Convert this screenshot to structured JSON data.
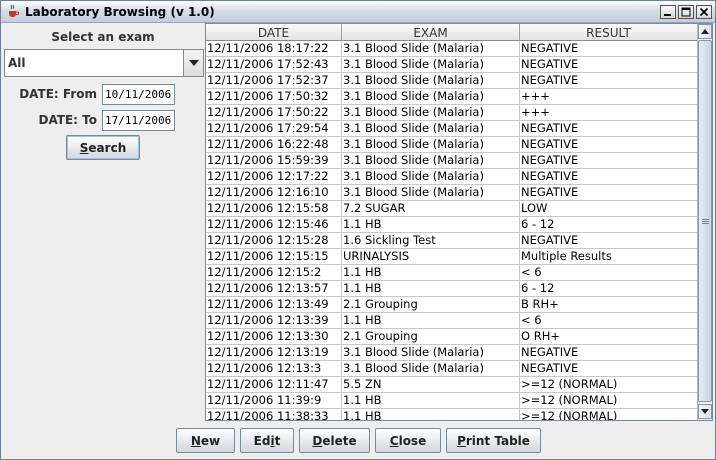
{
  "window": {
    "title": "Laboratory Browsing (v 1.0)",
    "controls": [
      "minimize-icon",
      "maximize-icon",
      "close-icon"
    ]
  },
  "filters": {
    "select_label": "Select an exam",
    "exam_value": "All",
    "date_from_label": "DATE: From",
    "date_from_value": "10/11/2006",
    "date_to_label": "DATE: To",
    "date_to_value": "17/11/2006",
    "search_label_prefix": "",
    "search_label_u": "S",
    "search_label_rest": "earch"
  },
  "table": {
    "columns": [
      "DATE",
      "EXAM",
      "RESULT"
    ],
    "rows": [
      [
        "12/11/2006  18:17:22",
        "3.1 Blood Slide (Malaria)",
        "NEGATIVE"
      ],
      [
        "12/11/2006  17:52:43",
        "3.1 Blood Slide (Malaria)",
        "NEGATIVE"
      ],
      [
        "12/11/2006  17:52:37",
        "3.1 Blood Slide (Malaria)",
        "NEGATIVE"
      ],
      [
        "12/11/2006  17:50:32",
        "3.1 Blood Slide (Malaria)",
        "+++"
      ],
      [
        "12/11/2006  17:50:22",
        "3.1 Blood Slide (Malaria)",
        "+++"
      ],
      [
        "12/11/2006  17:29:54",
        "3.1 Blood Slide (Malaria)",
        "NEGATIVE"
      ],
      [
        "12/11/2006  16:22:48",
        "3.1 Blood Slide (Malaria)",
        "NEGATIVE"
      ],
      [
        "12/11/2006  15:59:39",
        "3.1 Blood Slide (Malaria)",
        "NEGATIVE"
      ],
      [
        "12/11/2006  12:17:22",
        "3.1 Blood Slide (Malaria)",
        "NEGATIVE"
      ],
      [
        "12/11/2006  12:16:10",
        "3.1 Blood Slide (Malaria)",
        "NEGATIVE"
      ],
      [
        "12/11/2006  12:15:58",
        "7.2 SUGAR",
        "LOW"
      ],
      [
        "12/11/2006  12:15:46",
        "1.1 HB",
        "6 - 12"
      ],
      [
        "12/11/2006  12:15:28",
        "1.6 Sickling Test",
        "NEGATIVE"
      ],
      [
        "12/11/2006  12:15:15",
        "URINALYSIS",
        "Multiple Results"
      ],
      [
        "12/11/2006  12:15:2",
        "1.1 HB",
        "< 6"
      ],
      [
        "12/11/2006  12:13:57",
        "1.1 HB",
        "6 - 12"
      ],
      [
        "12/11/2006  12:13:49",
        "2.1 Grouping",
        "B RH+"
      ],
      [
        "12/11/2006  12:13:39",
        "1.1 HB",
        "< 6"
      ],
      [
        "12/11/2006  12:13:30",
        "2.1 Grouping",
        "O RH+"
      ],
      [
        "12/11/2006  12:13:19",
        "3.1 Blood Slide (Malaria)",
        "NEGATIVE"
      ],
      [
        "12/11/2006  12:13:3",
        "3.1 Blood Slide (Malaria)",
        "NEGATIVE"
      ],
      [
        "12/11/2006  12:11:47",
        "5.5 ZN",
        ">=12 (NORMAL)"
      ],
      [
        "12/11/2006  11:39:9",
        "1.1 HB",
        ">=12 (NORMAL)"
      ],
      [
        "12/11/2006  11:38:33",
        "1.1 HB",
        ">=12 (NORMAL)"
      ]
    ]
  },
  "buttons": {
    "new": {
      "u": "N",
      "rest": "ew"
    },
    "edit": {
      "pre": "Ed",
      "u": "i",
      "rest": "t"
    },
    "delete": {
      "u": "D",
      "rest": "elete"
    },
    "close": {
      "u": "C",
      "rest": "lose"
    },
    "print": {
      "u": "P",
      "rest": "rint Table"
    }
  }
}
